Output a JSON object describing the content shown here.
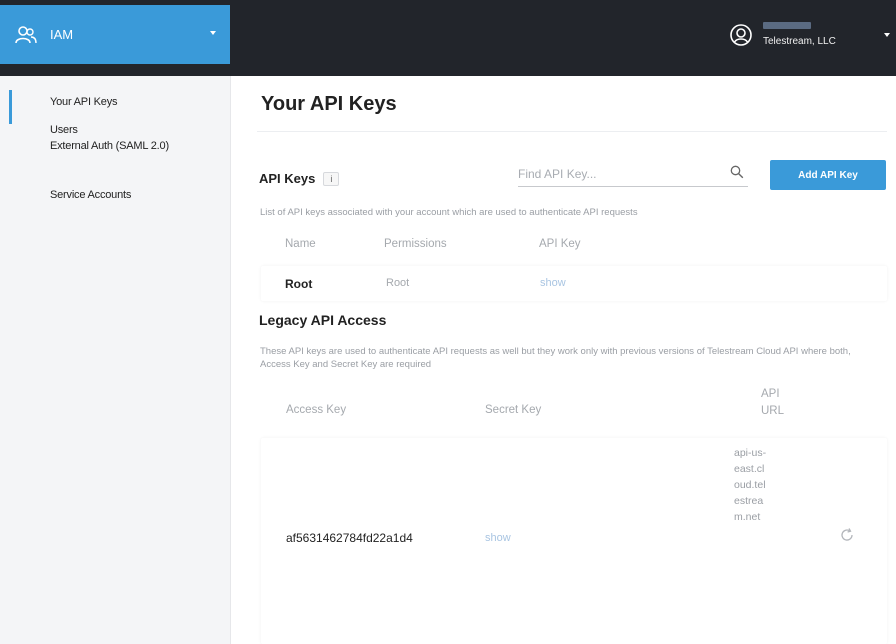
{
  "header": {
    "app_name": "IAM",
    "org_name": "Telestream, LLC"
  },
  "sidebar": {
    "items": [
      {
        "label": "Your API Keys"
      },
      {
        "label": "Users"
      },
      {
        "label": "External Auth (SAML 2.0)"
      },
      {
        "label": "Service Accounts"
      }
    ]
  },
  "page": {
    "title": "Your API Keys"
  },
  "api_keys": {
    "title": "API Keys",
    "info_badge": "i",
    "search_placeholder": "Find API Key...",
    "add_button": "Add API Key",
    "description": "List of API keys associated with your account which are used to authenticate API requests",
    "columns": [
      "Name",
      "Permissions",
      "API Key"
    ],
    "rows": [
      {
        "name": "Root",
        "permissions": "Root",
        "key_action": "show"
      }
    ]
  },
  "legacy": {
    "title": "Legacy API Access",
    "description": "These API keys are used to authenticate API requests as well but they work only with previous versions of Telestream Cloud API where both, Access Key and Secret Key are required",
    "columns": [
      "Access Key",
      "Secret Key",
      "API URL"
    ],
    "rows": [
      {
        "access_key": "af5631462784fd22a1d4",
        "secret_action": "show",
        "api_url": "api-us-east.cloud.telestream.net"
      }
    ]
  },
  "colors": {
    "accent": "#3a9ad9",
    "topbar": "#22252b",
    "sidebar_bg": "#f4f5f7"
  }
}
